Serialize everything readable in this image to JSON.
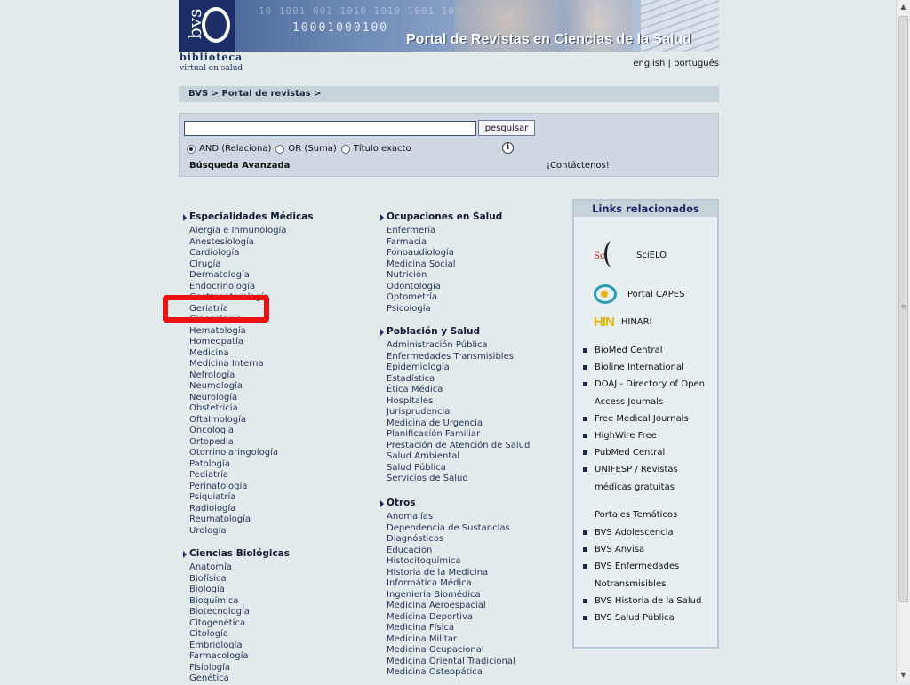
{
  "header": {
    "logo_text": "bvs",
    "binary_1": "10 1001 001 1010 1010 1001 1010 1020 01",
    "binary_2": "10001000100",
    "title": "Portal de Revistas en Ciencias de la Salud",
    "brand_line1": "biblioteca",
    "brand_line2": "virtual en salud"
  },
  "langs": {
    "english": "english",
    "separator": "|",
    "portugues": "português"
  },
  "breadcrumb": "BVS > Portal de revistas >",
  "search": {
    "value": "",
    "placeholder": "",
    "button": "pesquisar",
    "options": [
      {
        "label": "AND (Relaciona)",
        "selected": true
      },
      {
        "label": "OR (Suma)",
        "selected": false
      },
      {
        "label": "Título exacto",
        "selected": false
      }
    ],
    "info_icon": "i",
    "advanced": "Búsqueda Avanzada",
    "contact": "¡Contáctenos!"
  },
  "columns": {
    "especialidades": {
      "title": "Especialidades Médicas",
      "items": [
        "Alergia e Inmunología",
        "Anestesiología",
        "Cardiología",
        "Cirugía",
        "Dermatología",
        "Endocrinología",
        "Gastroenterología",
        "Geriatría",
        "Ginecología",
        "Hematología",
        "Homeopatía",
        "Medicina",
        "Medicina Interna",
        "Nefrología",
        "Neumología",
        "Neurología",
        "Obstetricia",
        "Oftalmología",
        "Oncología",
        "Ortopedia",
        "Otorrinolaringología",
        "Patología",
        "Pediatría",
        "Perinatología",
        "Psiquiatría",
        "Radiología",
        "Reumatología",
        "Urología"
      ]
    },
    "biologicas": {
      "title": "Ciencias Biológicas",
      "items": [
        "Anatomía",
        "Biofísica",
        "Biología",
        "Bioquímica",
        "Biotecnología",
        "Citogenética",
        "Citología",
        "Embriología",
        "Farmacología",
        "Fisiología",
        "Genética"
      ]
    },
    "ocupaciones": {
      "title": "Ocupaciones en Salud",
      "items": [
        "Enfermería",
        "Farmacia",
        "Fonoaudiología",
        "Medicina Social",
        "Nutrición",
        "Odontología",
        "Optometría",
        "Psicología"
      ]
    },
    "poblacion": {
      "title": "Población y Salud",
      "items": [
        "Administración Pública",
        "Enfermedades Transmisibles",
        "Epidemiología",
        "Estadística",
        "Ética Médica",
        "Hospitales",
        "Jurisprudencia",
        "Medicina de Urgencia",
        "Planificación Familiar",
        "Prestación de Atención de Salud",
        "Salud Ambiental",
        "Salud Pública",
        "Servicios de Salud"
      ]
    },
    "otros": {
      "title": "Otros",
      "items": [
        "Anomalías",
        "Dependencia de Sustancias",
        "Diagnósticos",
        "Educación",
        "Histocitoquímica",
        "Historia de la Medicina",
        "Informática Médica",
        "Ingeniería Biomédica",
        "Medicina Aeroespacial",
        "Medicina Deportiva",
        "Medicina Física",
        "Medicina Militar",
        "Medicina Ocupacional",
        "Medicina Oriental Tradicional",
        "Medicina Osteopática"
      ]
    }
  },
  "related": {
    "title": "Links relacionados",
    "partners": {
      "scielo": "SciELO",
      "capes": "Portal CAPES",
      "hinari": "HINARI",
      "hinari_logo": "HIN",
      "scielo_mark": "Sci"
    },
    "links": [
      "BioMed Central",
      "Bioline International",
      "DOAJ - Directory of Open",
      "Access Journals",
      "Free Medical Journals",
      "HighWire Free",
      "PubMed Central",
      "UNIFESP / Revistas",
      "médicas gratuitas"
    ],
    "portales_title": "Portales Temáticos",
    "portales": [
      "BVS Adolescencia",
      "BVS Anvisa",
      "BVS Enfermedades",
      "Notransmisibles",
      "BVS Historia de la Salud",
      "BVS Salud Pública"
    ]
  },
  "colors": {
    "highlight": "#ee1111",
    "accent": "#1d2f66"
  }
}
